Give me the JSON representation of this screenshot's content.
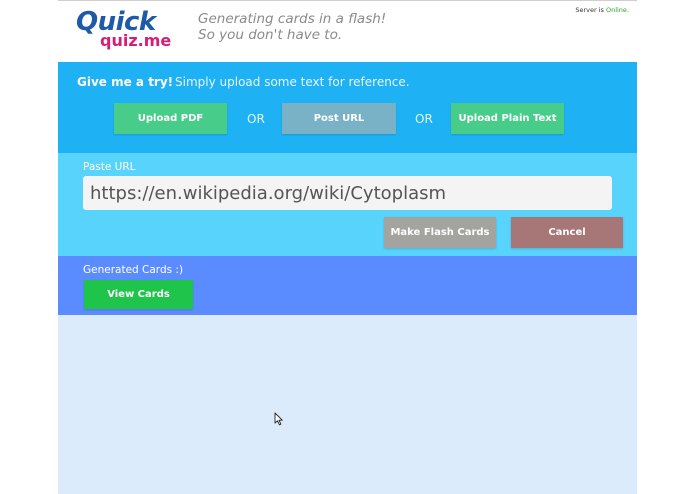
{
  "header": {
    "logo_line1": "Quick",
    "logo_line2": "quiz.me",
    "tagline_line1": "Generating cards in a flash!",
    "tagline_line2": "So you don't have to.",
    "server_prefix": "Server is ",
    "server_status": "Online."
  },
  "upload": {
    "title": "Give me a try!",
    "subtitle": "Simply upload some text for reference.",
    "upload_pdf_label": "Upload PDF",
    "or1": "OR",
    "post_url_label": "Post URL",
    "or2": "OR",
    "upload_text_label": "Upload Plain Text"
  },
  "url_form": {
    "label": "Paste URL",
    "value": "https://en.wikipedia.org/wiki/Cytoplasm",
    "make_label": "Make Flash Cards",
    "cancel_label": "Cancel"
  },
  "generated": {
    "label": "Generated Cards :)",
    "view_label": "View Cards"
  },
  "icons": {
    "cursor": "mouse-pointer-icon"
  },
  "colors": {
    "brand_blue": "#1f5aa6",
    "brand_pink": "#d61e79",
    "upload_bg": "#1eb2f4",
    "url_bg": "#58d3fb",
    "generated_bg": "#5b8cff",
    "green": "#47cc8a",
    "online": "#2aa22a"
  }
}
